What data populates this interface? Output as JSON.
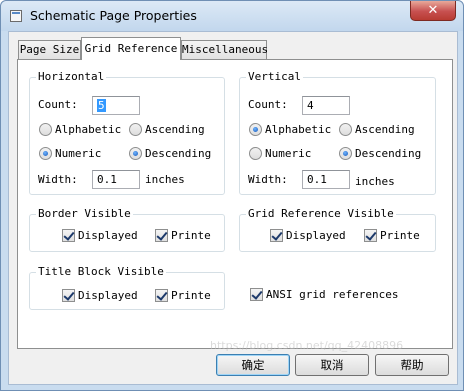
{
  "window": {
    "title": "Schematic Page Properties",
    "close_glyph": "✕"
  },
  "tabs": [
    {
      "label": "Page Size"
    },
    {
      "label": "Grid Reference"
    },
    {
      "label": "Miscellaneous"
    }
  ],
  "horizontal": {
    "title": "Horizontal",
    "count_label": "Count:",
    "count_value": "5",
    "alphabetic": "Alphabetic",
    "ascending": "Ascending",
    "numeric": "Numeric",
    "descending": "Descending",
    "width_label": "Width:",
    "width_value": "0.1",
    "width_unit": "inches"
  },
  "vertical": {
    "title": "Vertical",
    "count_label": "Count:",
    "count_value": "4",
    "alphabetic": "Alphabetic",
    "ascending": "Ascending",
    "numeric": "Numeric",
    "descending": "Descending",
    "width_label": "Width:",
    "width_value": "0.1",
    "width_unit": "inches"
  },
  "border_visible": {
    "title": "Border Visible",
    "displayed": "Displayed",
    "printed": "Printe"
  },
  "grid_ref_visible": {
    "title": "Grid Reference Visible",
    "displayed": "Displayed",
    "printed": "Printe"
  },
  "title_block_visible": {
    "title": "Title Block Visible",
    "displayed": "Displayed",
    "printed": "Printe"
  },
  "ansi": {
    "label": "ANSI grid references"
  },
  "buttons": {
    "ok": "确定",
    "cancel": "取消",
    "help": "帮助"
  },
  "watermark": "https://blog.csdn.net/qq_42408896"
}
